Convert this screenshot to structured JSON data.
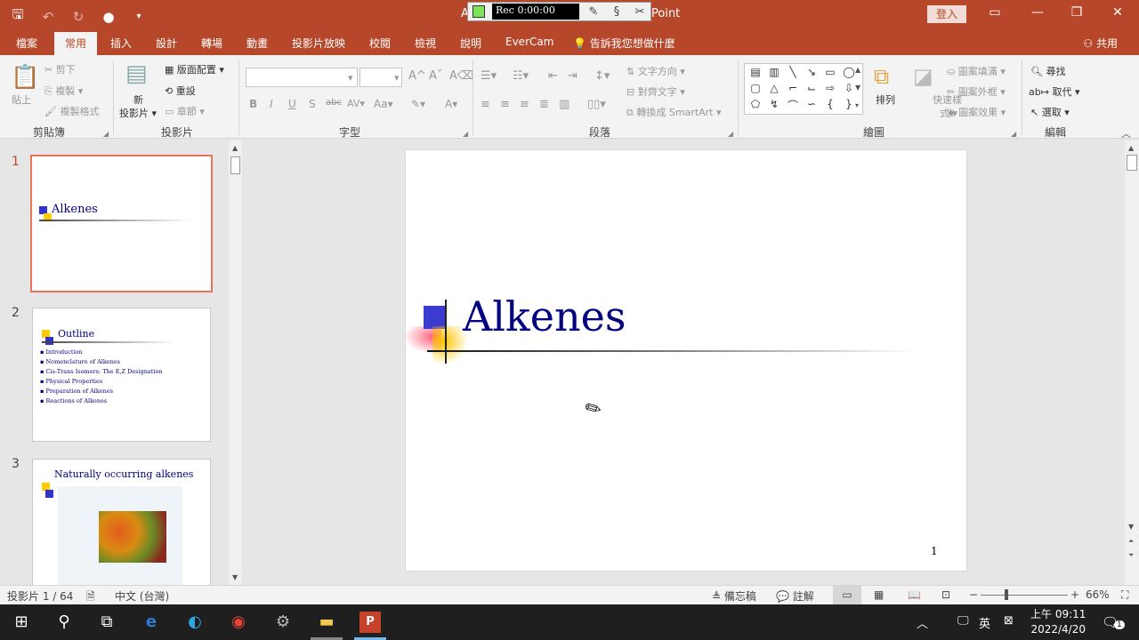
{
  "titlebar": {
    "title_left": "A",
    "title_right": "Point",
    "recorder_time": "Rec 0:00:00",
    "login": "登入"
  },
  "tabs": [
    "檔案",
    "常用",
    "插入",
    "設計",
    "轉場",
    "動畫",
    "投影片放映",
    "校閱",
    "檢視",
    "說明",
    "EverCam"
  ],
  "tell_me": "告訴我您想做什麼",
  "share": "共用",
  "ribbon": {
    "clipboard": {
      "label": "剪貼簿",
      "paste": "貼上",
      "cut": "剪下",
      "copy": "複製",
      "format_painter": "複製格式"
    },
    "slides": {
      "label": "投影片",
      "new_slide_1": "新",
      "new_slide_2": "投影片",
      "layout": "版面配置",
      "reset": "重設",
      "section": "章節"
    },
    "font": {
      "label": "字型"
    },
    "paragraph": {
      "label": "段落",
      "text_direction": "文字方向",
      "align_text": "對齊文字",
      "smartart": "轉換成 SmartArt"
    },
    "drawing": {
      "label": "繪圖",
      "arrange": "排列",
      "quick_styles_1": "快速樣",
      "quick_styles_2": "式",
      "shape_fill": "圖案填滿",
      "shape_outline": "圖案外框",
      "shape_effects": "圖案效果"
    },
    "editing": {
      "label": "編輯",
      "find": "尋找",
      "replace": "取代",
      "select": "選取"
    }
  },
  "thumbnails": [
    {
      "num": "1",
      "title": "Alkenes"
    },
    {
      "num": "2",
      "title": "Outline",
      "bullets": [
        "Introduction",
        "Nomenclature of Alkenes",
        "Cis-Trans Isomers: The E,Z Designation",
        "Physical Properties",
        "Preparation of Alkenes",
        "Reactions of Alkenes"
      ]
    },
    {
      "num": "3",
      "title": "Naturally occurring alkenes"
    }
  ],
  "slide": {
    "title": "Alkenes",
    "number": "1"
  },
  "status": {
    "slide_info": "投影片 1 / 64",
    "language": "中文 (台灣)",
    "notes": "備忘稿",
    "comments": "註解",
    "zoom": "66%"
  },
  "taskbar": {
    "ime": "英",
    "time": "上午 09:11",
    "date": "2022/4/20",
    "notif_count": "1"
  }
}
